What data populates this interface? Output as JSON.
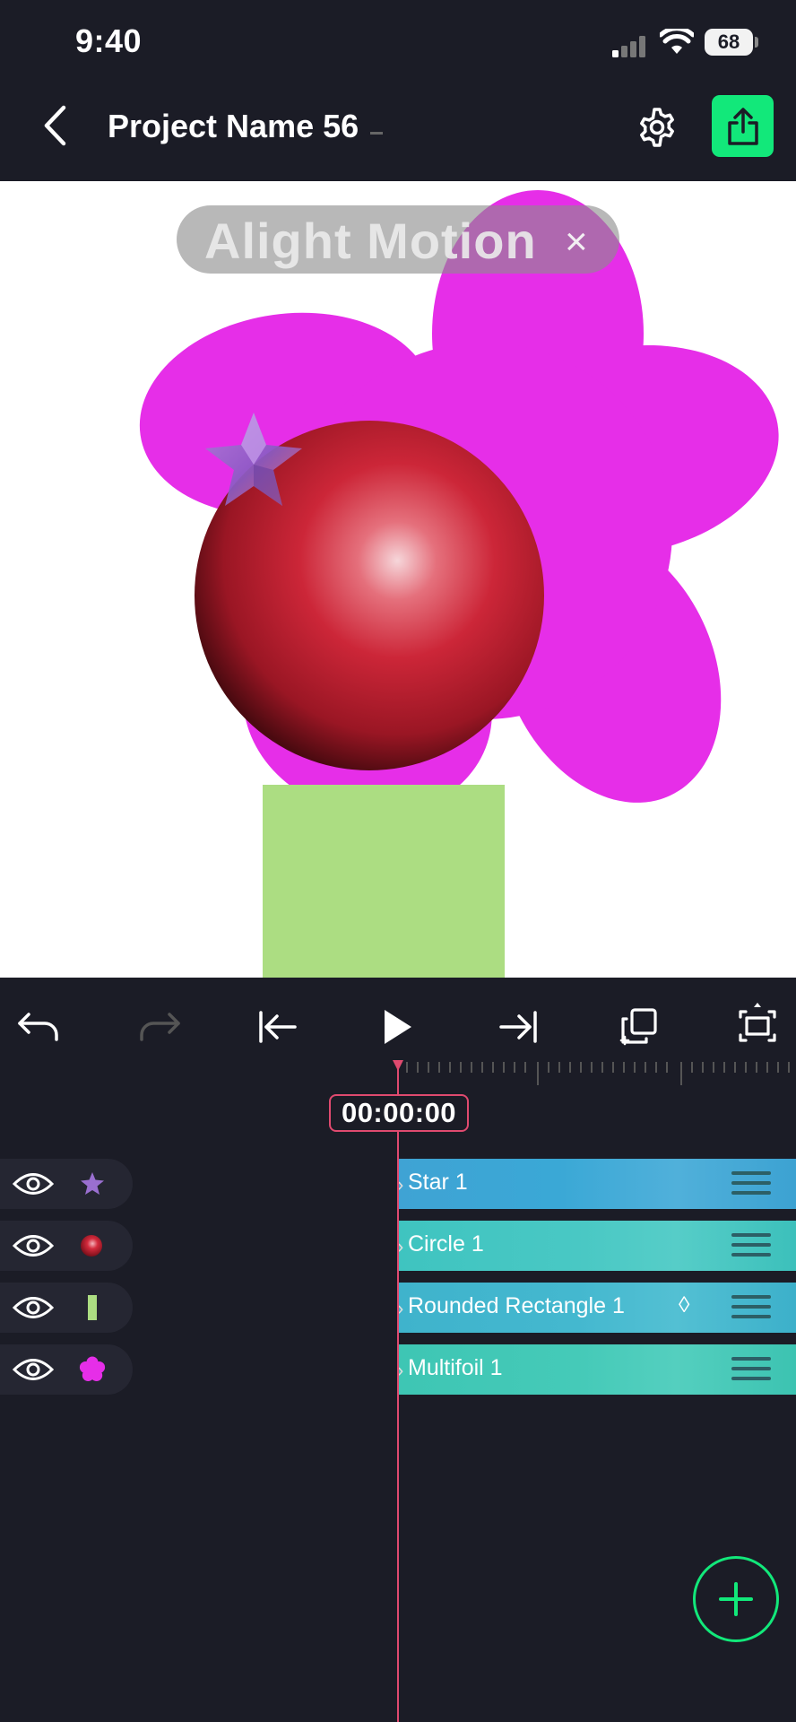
{
  "status_bar": {
    "time": "9:40",
    "battery": "68"
  },
  "header": {
    "title": "Project Name 56"
  },
  "canvas": {
    "watermark_text": "Alight Motion",
    "watermark_close": "×"
  },
  "timeline": {
    "timecode": "00:00:00"
  },
  "layers": [
    {
      "name": "Star 1",
      "thumb": "star-thumb",
      "color": "#3fa3d4"
    },
    {
      "name": "Circle 1",
      "thumb": "circle-thumb",
      "color": "#3fc4c0"
    },
    {
      "name": "Rounded Rectangle 1",
      "thumb": "rect-thumb",
      "color": "#3fb3cc",
      "keyframe": "◊"
    },
    {
      "name": "Multifoil 1",
      "thumb": "flower-thumb",
      "color": "#3ec6b4"
    }
  ],
  "colors": {
    "accent": "#12e87a",
    "playhead": "#e04a6f",
    "background": "#1b1c26",
    "flower": "#e62ee8",
    "rectangle": "#acdd82"
  }
}
